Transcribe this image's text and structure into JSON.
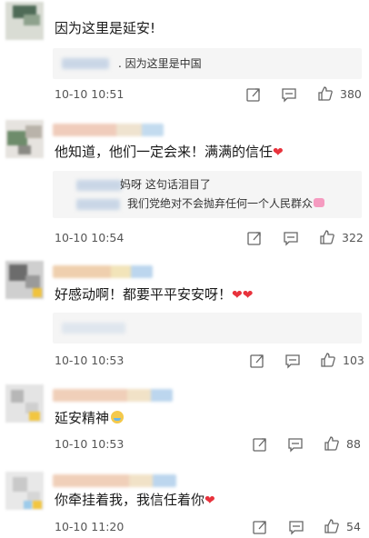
{
  "comments": [
    {
      "text": "因为这里是延安!",
      "reply": {
        "lines": [
          {
            "text": ". 因为这里是中国"
          }
        ]
      },
      "time": "10-10 10:51",
      "icons": {
        "share": "share-icon",
        "comment": "comment-icon",
        "like": "like-icon"
      },
      "likes": "380"
    },
    {
      "text": "他知道，他们一定会来！满满的信任",
      "reply": {
        "lines": [
          {
            "text": "妈呀 这句话泪目了"
          },
          {
            "text": "我们党绝对不会抛弃任何一个人民群众"
          }
        ]
      },
      "time": "10-10 10:54",
      "likes": "322"
    },
    {
      "text": "好感动啊！都要平平安安呀！",
      "time": "10-10 10:53",
      "likes": "103"
    },
    {
      "text": "延安精神",
      "time": "10-10 10:53",
      "likes": "88"
    },
    {
      "text": "你牵挂着我，我信任着你",
      "time": "10-10 11:20",
      "likes": "54"
    }
  ],
  "colors": {
    "heart": "#e8323c",
    "reply_bg": "#f5f5f5",
    "meta_text": "#555555"
  }
}
